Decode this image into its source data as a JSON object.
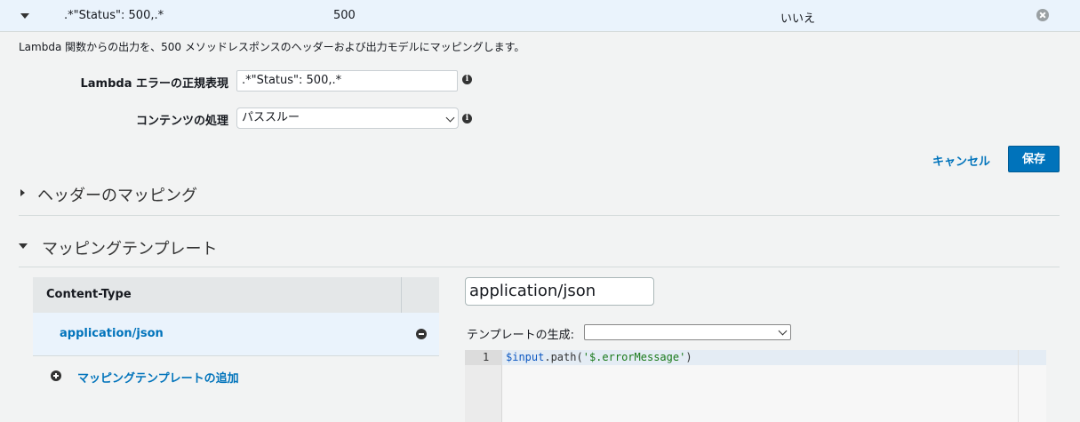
{
  "response_row": {
    "regex": ".*\"Status\": 500,.*",
    "status_code": "500",
    "default": "いいえ"
  },
  "description": "Lambda 関数からの出力を、500 メソッドレスポンスのヘッダーおよび出力モデルにマッピングします。",
  "form": {
    "regex_label": "Lambda エラーの正規表現",
    "regex_value": ".*\"Status\": 500,.*",
    "content_handling_label": "コンテンツの処理",
    "content_handling_value": "パススルー"
  },
  "actions": {
    "cancel_label": "キャンセル",
    "save_label": "保存"
  },
  "header_mappings": {
    "title": "ヘッダーのマッピング"
  },
  "mapping_templates": {
    "title": "マッピングテンプレート",
    "table_header": "Content-Type",
    "rows": [
      "application/json"
    ],
    "add_label": "マッピングテンプレートの追加",
    "content_type_value": "application/json",
    "generate_label": "テンプレートの生成:",
    "generate_value": ""
  },
  "editor": {
    "line_number": "1",
    "code_var": "$input",
    "code_dot_method": ".path(",
    "code_string": "'$.errorMessage'",
    "code_close": ")"
  },
  "colors": {
    "accent": "#0073bb",
    "row_highlight": "#eaf3fc"
  }
}
